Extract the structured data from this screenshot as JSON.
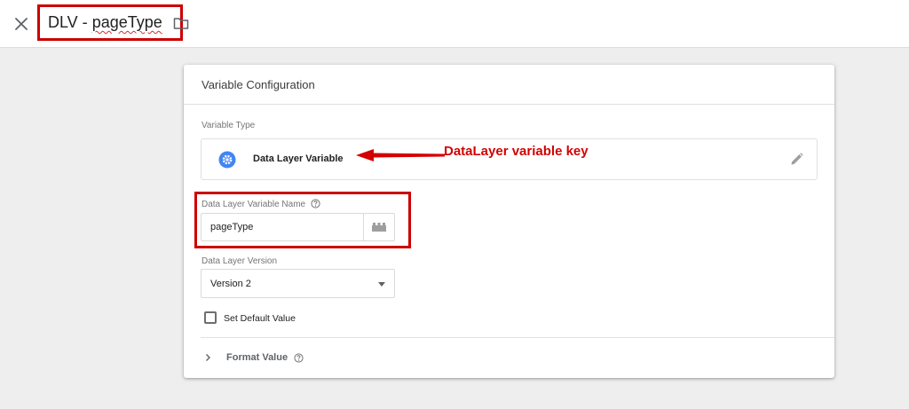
{
  "header": {
    "title_prefix": "DLV - ",
    "title_misspelled": "pageType"
  },
  "config": {
    "title": "Variable Configuration",
    "variable_type_label": "Variable Type",
    "variable_type_name": "Data Layer Variable",
    "name_label": "Data Layer Variable Name",
    "name_value": "pageType",
    "version_label": "Data Layer Version",
    "version_value": "Version 2",
    "default_value_label": "Set Default Value",
    "format_value_label": "Format Value"
  },
  "annotation": {
    "text": "DataLayer variable key",
    "color": "#d40000"
  },
  "icons": {
    "close": "close-icon",
    "folder": "folder-icon",
    "variable_type": "gear-icon",
    "edit": "pencil-icon",
    "variable_picker": "lego-brick-icon",
    "help": "question-circle-icon",
    "expand": "chevron-right-icon"
  },
  "colors": {
    "accent_blue": "#4285f4",
    "highlight_red": "#cc0000"
  }
}
